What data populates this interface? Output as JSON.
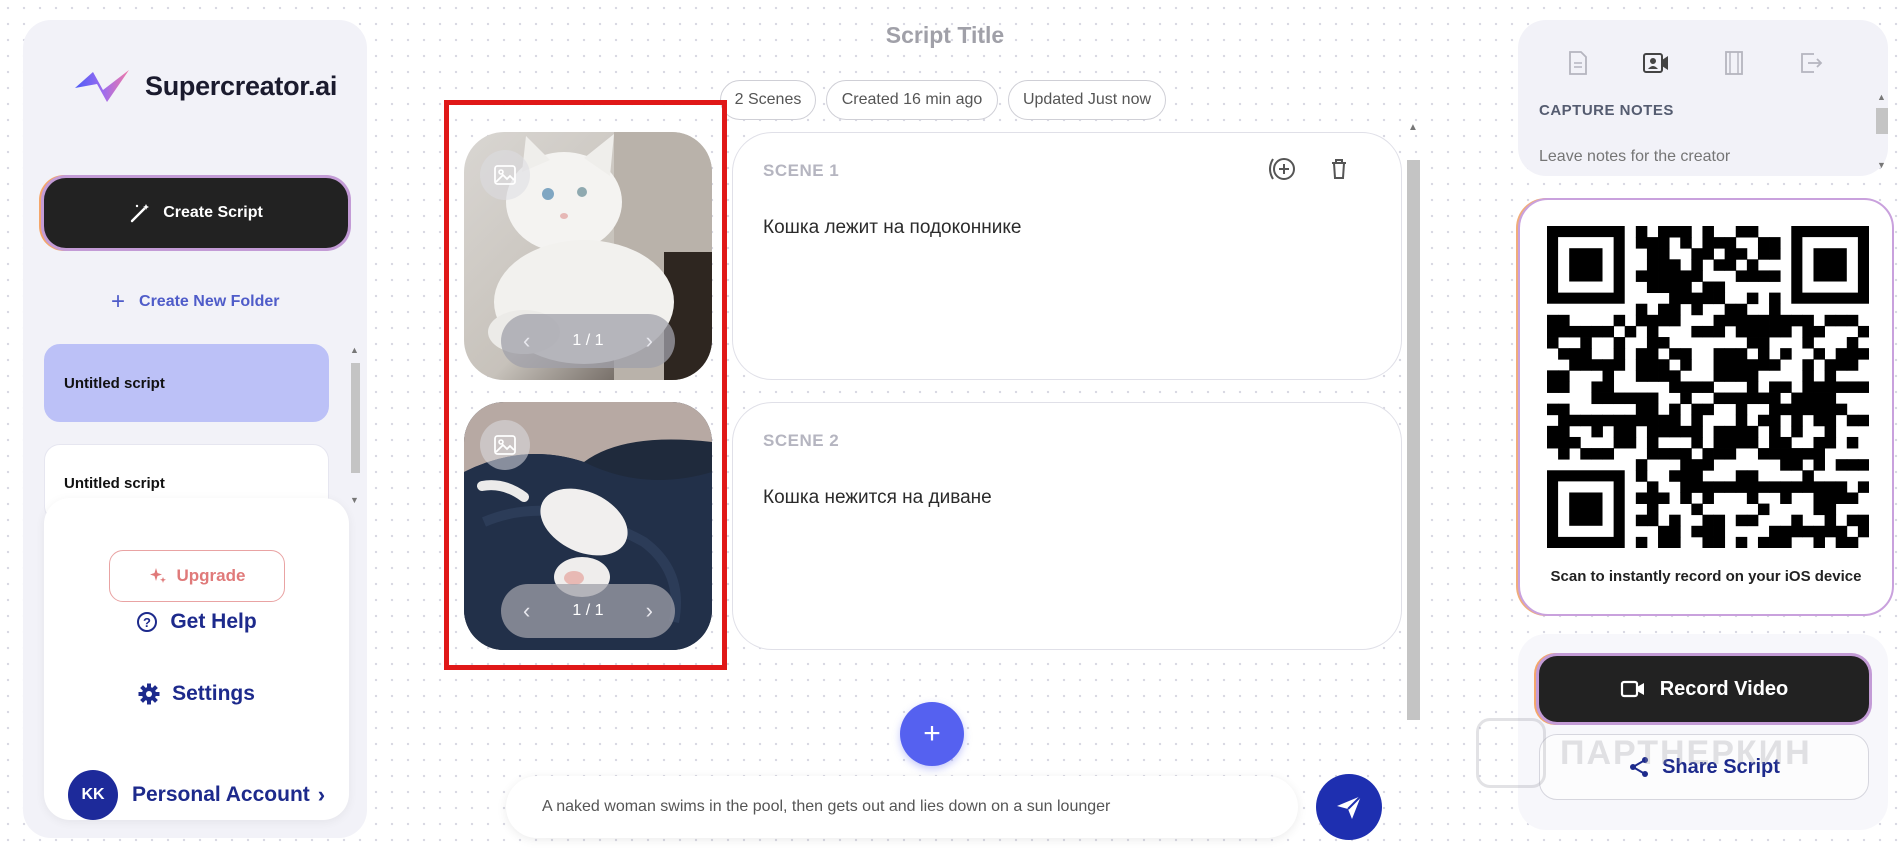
{
  "app": {
    "name": "Supercreator.ai"
  },
  "sidebar": {
    "create_script": "Create Script",
    "create_folder": "Create New Folder",
    "scripts": [
      {
        "label": "Untitled script",
        "active": true
      },
      {
        "label": "Untitled script",
        "active": false
      }
    ],
    "upgrade": "Upgrade",
    "get_help": "Get Help",
    "settings": "Settings",
    "account": {
      "initials": "KK",
      "label": "Personal Account"
    }
  },
  "main": {
    "title": "Script Title",
    "meta": {
      "scenes": "2 Scenes",
      "created": "Created 16 min ago",
      "updated": "Updated Just now"
    },
    "scenes": [
      {
        "label": "SCENE 1",
        "text": "Кошка лежит на подоконнике",
        "pager": "1 / 1"
      },
      {
        "label": "SCENE 2",
        "text": "Кошка нежится на диване",
        "pager": "1 / 1"
      }
    ],
    "add_label": "+",
    "prompt_value": "A naked woman swims in the pool, then gets out and lies down on a sun lounger"
  },
  "right": {
    "notes_title": "CAPTURE NOTES",
    "notes_placeholder": "Leave notes for the creator",
    "qr_caption": "Scan to instantly record on your iOS device",
    "record_video": "Record Video",
    "share_script": "Share Script"
  },
  "watermark": "ПАРТНЕРКИН",
  "colors": {
    "accent": "#5561f0",
    "navy": "#1d2a8c",
    "highlight": "#e01818",
    "active_script": "#bcc1f7"
  }
}
